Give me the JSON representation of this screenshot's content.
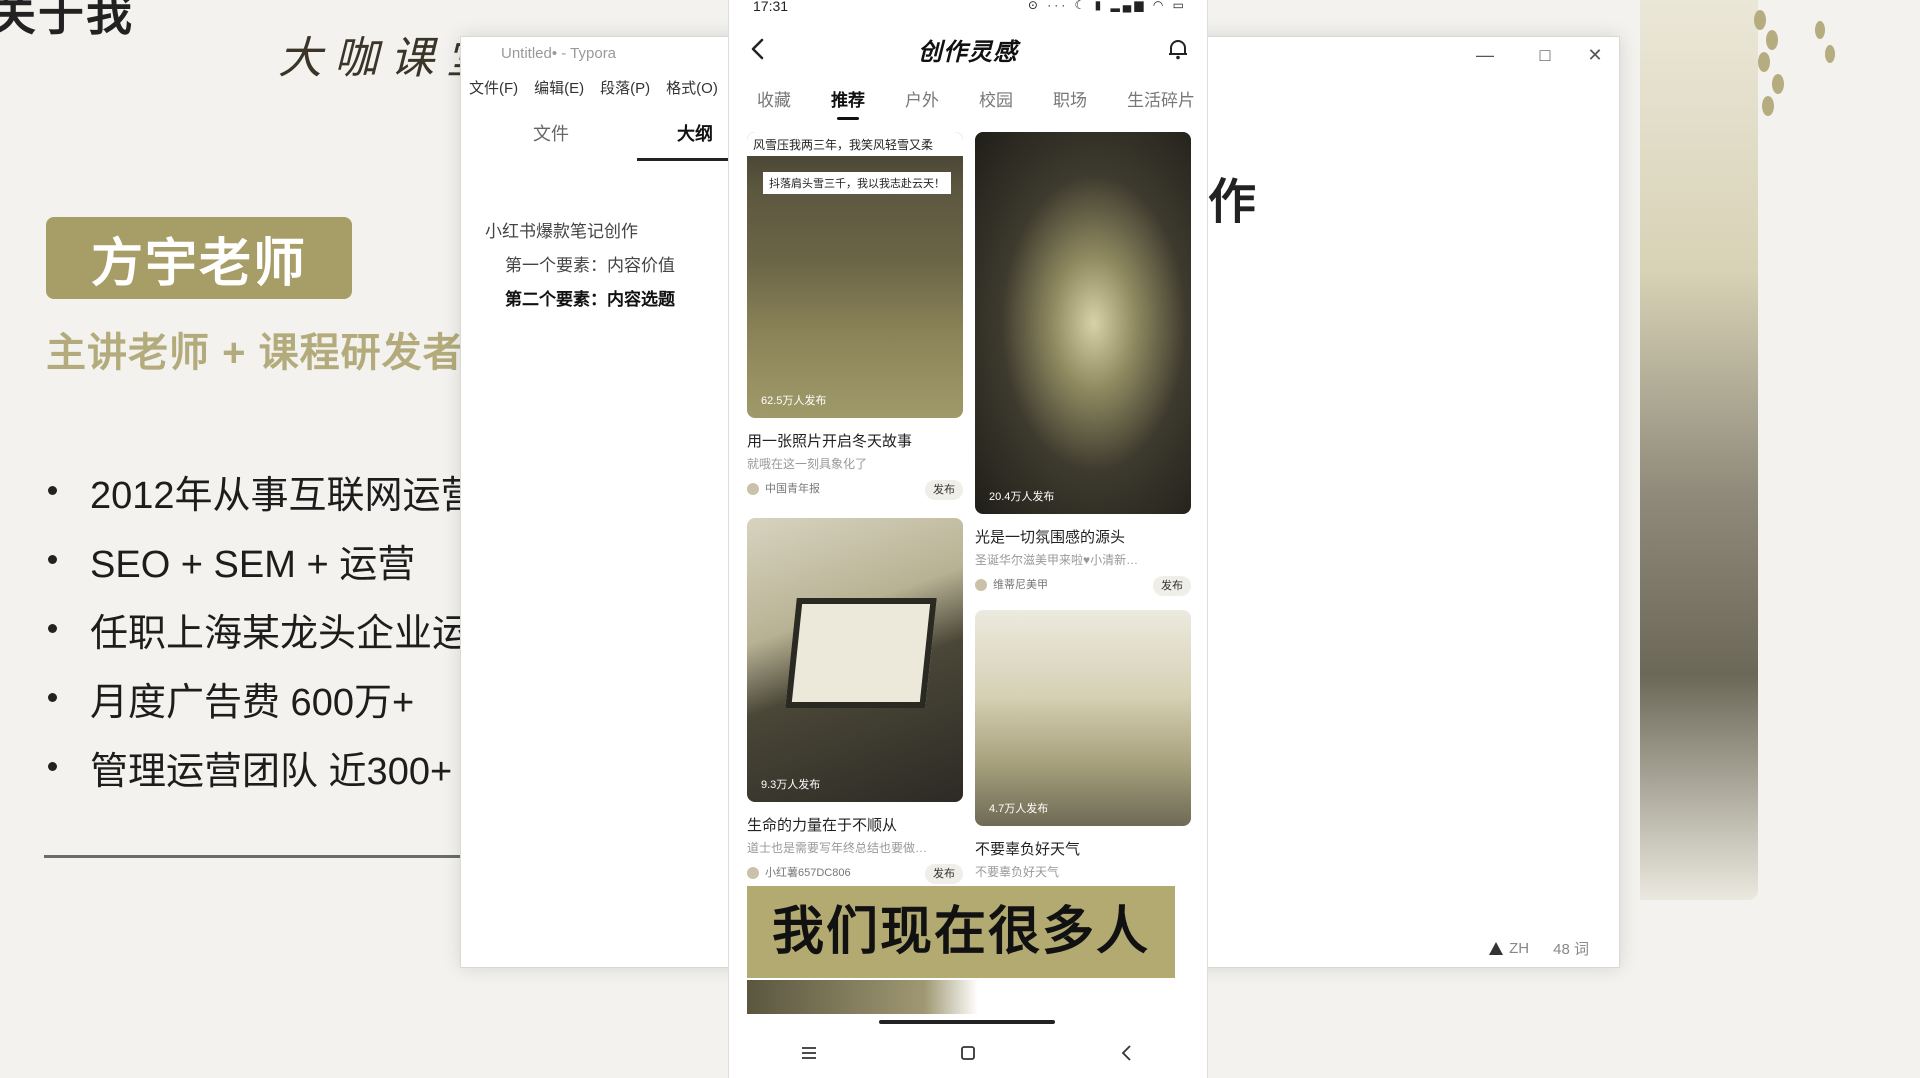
{
  "slide": {
    "title": "关于我",
    "brand": "大咖课堂",
    "teacher_name": "方宇老师",
    "teacher_subtitle": "主讲老师 + 课程研发者",
    "bullets": [
      "2012年从事互联网运营",
      "SEO + SEM + 运营",
      "任职上海某龙头企业运",
      "月度广告费 600万+",
      "管理运营团队 近300+"
    ],
    "partial_char": "作"
  },
  "typora": {
    "title": "Untitled• - Typora",
    "menu": [
      "文件(F)",
      "编辑(E)",
      "段落(P)",
      "格式(O)"
    ],
    "sidebar_tabs": {
      "files": "文件",
      "outline": "大纲"
    },
    "outline": [
      {
        "label": "小红书爆款笔记创作",
        "level": 1
      },
      {
        "label": "第一个要素：内容价值",
        "level": 2
      },
      {
        "label": "第二个要素：内容选题",
        "level": 2,
        "active": true
      }
    ],
    "status": {
      "lang": "ZH",
      "words": "48 词"
    }
  },
  "phone": {
    "status_time": "17:31",
    "status_icons": "⊙ ··· ☾ ▮ ▂▄▆ ◠ ▭",
    "app_title": "创作灵感",
    "tabs": [
      "收藏",
      "推荐",
      "户外",
      "校园",
      "职场",
      "生活碎片"
    ],
    "active_tab": "推荐",
    "cards": [
      {
        "caption1": "风雪压我两三年，我笑风轻雪又柔",
        "caption2": "抖落肩头雪三千，我以我志赴云天！",
        "count": "62.5万人发布",
        "title": "用一张照片开启冬天故事",
        "subtitle": "就哦在这一刻具象化了",
        "author": "中国青年报",
        "action": "发布"
      },
      {
        "count": "20.4万人发布",
        "title": "光是一切氛围感的源头",
        "subtitle": "圣诞华尔滋美甲来啦♥小清新…",
        "author": "维蒂尼美甲",
        "action": "发布"
      },
      {
        "count": "9.3万人发布",
        "title": "生命的力量在于不顺从",
        "subtitle": "道士也是需要写年终总结也要做…",
        "author": "小红薯657DC806",
        "action": "发布"
      },
      {
        "count": "4.7万人发布",
        "title": "不要辜负好天气",
        "subtitle": "不要辜负好天气"
      }
    ],
    "subtitle_caption": "我们现在很多人"
  },
  "colors": {
    "accent_olive": "#a79d67",
    "caption_bg": "#b3aa72"
  }
}
